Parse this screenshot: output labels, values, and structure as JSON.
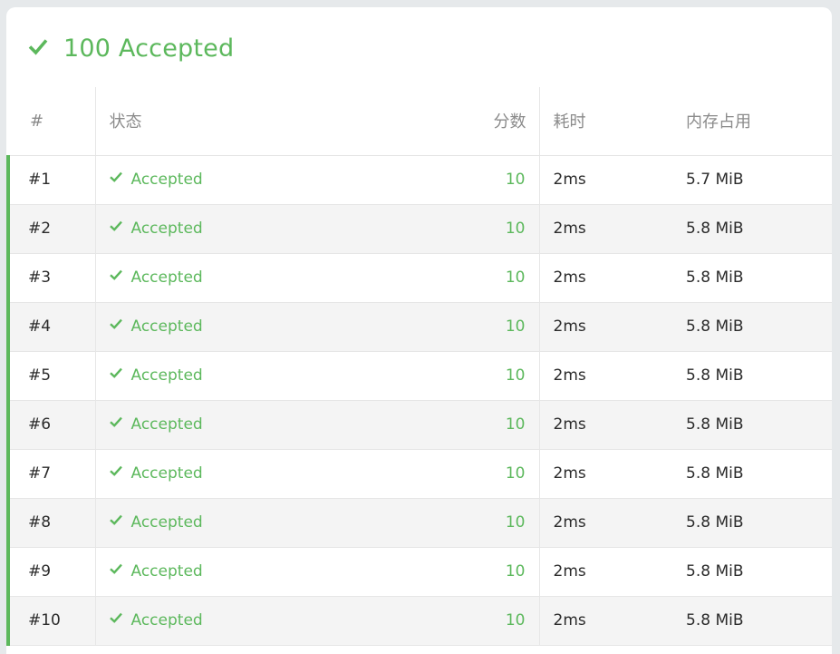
{
  "summary": {
    "score": "100",
    "status": "Accepted",
    "title": "100 Accepted"
  },
  "columns": {
    "num": "#",
    "status": "状态",
    "score": "分数",
    "time": "耗时",
    "memory": "内存占用"
  },
  "rows": [
    {
      "num": "#1",
      "status": "Accepted",
      "score": "10",
      "time": "2ms",
      "memory": "5.7 MiB"
    },
    {
      "num": "#2",
      "status": "Accepted",
      "score": "10",
      "time": "2ms",
      "memory": "5.8 MiB"
    },
    {
      "num": "#3",
      "status": "Accepted",
      "score": "10",
      "time": "2ms",
      "memory": "5.8 MiB"
    },
    {
      "num": "#4",
      "status": "Accepted",
      "score": "10",
      "time": "2ms",
      "memory": "5.8 MiB"
    },
    {
      "num": "#5",
      "status": "Accepted",
      "score": "10",
      "time": "2ms",
      "memory": "5.8 MiB"
    },
    {
      "num": "#6",
      "status": "Accepted",
      "score": "10",
      "time": "2ms",
      "memory": "5.8 MiB"
    },
    {
      "num": "#7",
      "status": "Accepted",
      "score": "10",
      "time": "2ms",
      "memory": "5.8 MiB"
    },
    {
      "num": "#8",
      "status": "Accepted",
      "score": "10",
      "time": "2ms",
      "memory": "5.8 MiB"
    },
    {
      "num": "#9",
      "status": "Accepted",
      "score": "10",
      "time": "2ms",
      "memory": "5.8 MiB"
    },
    {
      "num": "#10",
      "status": "Accepted",
      "score": "10",
      "time": "2ms",
      "memory": "5.8 MiB"
    }
  ],
  "icons": {
    "summary": "check-icon",
    "row": "check-icon"
  },
  "colors": {
    "accent": "#5cb85c",
    "row_alt": "#f4f4f4",
    "text": "#2b2b2b",
    "header_text": "#8b8b8b"
  }
}
